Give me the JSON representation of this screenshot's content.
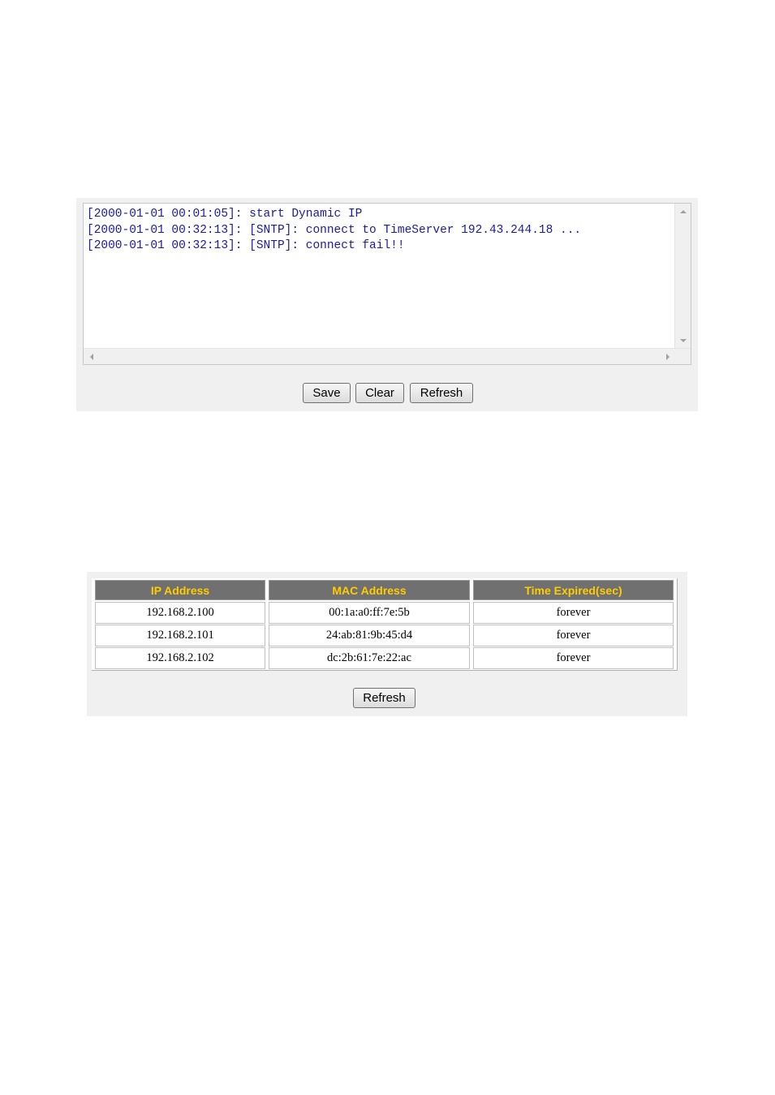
{
  "system_log": {
    "lines": [
      "[2000-01-01 00:01:05]: start Dynamic IP",
      "[2000-01-01 00:32:13]: [SNTP]: connect to TimeServer 192.43.244.18 ...",
      "[2000-01-01 00:32:13]: [SNTP]: connect fail!!"
    ],
    "buttons": {
      "save": "Save",
      "clear": "Clear",
      "refresh": "Refresh"
    }
  },
  "dhcp_table": {
    "headers": [
      "IP Address",
      "MAC Address",
      "Time Expired(sec)"
    ],
    "rows": [
      [
        "192.168.2.100",
        "00:1a:a0:ff:7e:5b",
        "forever"
      ],
      [
        "192.168.2.101",
        "24:ab:81:9b:45:d4",
        "forever"
      ],
      [
        "192.168.2.102",
        "dc:2b:61:7e:22:ac",
        "forever"
      ]
    ],
    "refresh_label": "Refresh"
  },
  "colors": {
    "log_text": "#1a1aa6",
    "header_bg": "#707070",
    "header_text": "#ffcc00",
    "panel_bg": "#f0f0f0"
  },
  "icons": [
    "scroll-up-arrow-icon",
    "scroll-down-arrow-icon",
    "scroll-left-arrow-icon",
    "scroll-right-arrow-icon"
  ]
}
